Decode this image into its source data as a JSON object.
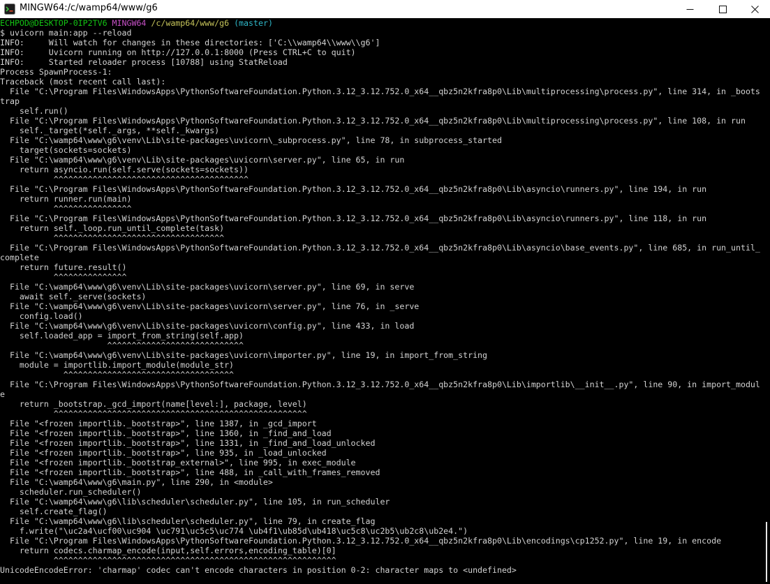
{
  "window": {
    "title": "MINGW64:/c/wamp64/www/g6",
    "controls": {
      "minimize": "minimize",
      "maximize": "maximize",
      "close": "close"
    }
  },
  "terminal": {
    "colors": {
      "default": "#d3d3d3",
      "user_host": "#13c313",
      "shell": "#c651c6",
      "path": "#c5c35a",
      "branch": "#2fb7c8"
    },
    "prompt": {
      "user_host": "ECHPOD@DESKTOP-0IP2TV6",
      "shell": "MINGW64",
      "path": "/c/wamp64/www/g6",
      "branch": "(master)"
    },
    "lines": [
      "$ uvicorn main:app --reload",
      "INFO:     Will watch for changes in these directories: ['C:\\\\wamp64\\\\www\\\\g6']",
      "INFO:     Uvicorn running on http://127.0.0.1:8000 (Press CTRL+C to quit)",
      "INFO:     Started reloader process [10788] using StatReload",
      "Process SpawnProcess-1:",
      "Traceback (most recent call last):",
      "  File \"C:\\Program Files\\WindowsApps\\PythonSoftwareFoundation.Python.3.12_3.12.752.0_x64__qbz5n2kfra8p0\\Lib\\multiprocessing\\process.py\", line 314, in _boots",
      "trap",
      "    self.run()",
      "  File \"C:\\Program Files\\WindowsApps\\PythonSoftwareFoundation.Python.3.12_3.12.752.0_x64__qbz5n2kfra8p0\\Lib\\multiprocessing\\process.py\", line 108, in run",
      "    self._target(*self._args, **self._kwargs)",
      "  File \"C:\\wamp64\\www\\g6\\venv\\Lib\\site-packages\\uvicorn\\_subprocess.py\", line 78, in subprocess_started",
      "    target(sockets=sockets)",
      "  File \"C:\\wamp64\\www\\g6\\venv\\Lib\\site-packages\\uvicorn\\server.py\", line 65, in run",
      "    return asyncio.run(self.serve(sockets=sockets))",
      "           ^^^^^^^^^^^^^^^^^^^^^^^^^^^^^^^^^^^^^^^^",
      "  File \"C:\\Program Files\\WindowsApps\\PythonSoftwareFoundation.Python.3.12_3.12.752.0_x64__qbz5n2kfra8p0\\Lib\\asyncio\\runners.py\", line 194, in run",
      "    return runner.run(main)",
      "           ^^^^^^^^^^^^^^^^",
      "  File \"C:\\Program Files\\WindowsApps\\PythonSoftwareFoundation.Python.3.12_3.12.752.0_x64__qbz5n2kfra8p0\\Lib\\asyncio\\runners.py\", line 118, in run",
      "    return self._loop.run_until_complete(task)",
      "           ^^^^^^^^^^^^^^^^^^^^^^^^^^^^^^^^^^^",
      "  File \"C:\\Program Files\\WindowsApps\\PythonSoftwareFoundation.Python.3.12_3.12.752.0_x64__qbz5n2kfra8p0\\Lib\\asyncio\\base_events.py\", line 685, in run_until_",
      "complete",
      "    return future.result()",
      "           ^^^^^^^^^^^^^^^",
      "  File \"C:\\wamp64\\www\\g6\\venv\\Lib\\site-packages\\uvicorn\\server.py\", line 69, in serve",
      "    await self._serve(sockets)",
      "  File \"C:\\wamp64\\www\\g6\\venv\\Lib\\site-packages\\uvicorn\\server.py\", line 76, in _serve",
      "    config.load()",
      "  File \"C:\\wamp64\\www\\g6\\venv\\Lib\\site-packages\\uvicorn\\config.py\", line 433, in load",
      "    self.loaded_app = import_from_string(self.app)",
      "                      ^^^^^^^^^^^^^^^^^^^^^^^^^^^^",
      "  File \"C:\\wamp64\\www\\g6\\venv\\Lib\\site-packages\\uvicorn\\importer.py\", line 19, in import_from_string",
      "    module = importlib.import_module(module_str)",
      "             ^^^^^^^^^^^^^^^^^^^^^^^^^^^^^^^^^^^",
      "  File \"C:\\Program Files\\WindowsApps\\PythonSoftwareFoundation.Python.3.12_3.12.752.0_x64__qbz5n2kfra8p0\\Lib\\importlib\\__init__.py\", line 90, in import_modul",
      "e",
      "    return _bootstrap._gcd_import(name[level:], package, level)",
      "           ^^^^^^^^^^^^^^^^^^^^^^^^^^^^^^^^^^^^^^^^^^^^^^^^^^^^",
      "  File \"<frozen importlib._bootstrap>\", line 1387, in _gcd_import",
      "  File \"<frozen importlib._bootstrap>\", line 1360, in _find_and_load",
      "  File \"<frozen importlib._bootstrap>\", line 1331, in _find_and_load_unlocked",
      "  File \"<frozen importlib._bootstrap>\", line 935, in _load_unlocked",
      "  File \"<frozen importlib._bootstrap_external>\", line 995, in exec_module",
      "  File \"<frozen importlib._bootstrap>\", line 488, in _call_with_frames_removed",
      "  File \"C:\\wamp64\\www\\g6\\main.py\", line 290, in <module>",
      "    scheduler.run_scheduler()",
      "  File \"C:\\wamp64\\www\\g6\\lib\\scheduler\\scheduler.py\", line 105, in run_scheduler",
      "    self.create_flag()",
      "  File \"C:\\wamp64\\www\\g6\\lib\\scheduler\\scheduler.py\", line 79, in create_flag",
      "    f.write(\"\\uc2a4\\ucf00\\uc904 \\uc791\\uc5c5\\uc774 \\ub4f1\\ub85d\\ub418\\uc5c8\\uc2b5\\ub2c8\\ub2e4.\")",
      "  File \"C:\\Program Files\\WindowsApps\\PythonSoftwareFoundation.Python.3.12_3.12.752.0_x64__qbz5n2kfra8p0\\Lib\\encodings\\cp1252.py\", line 19, in encode",
      "    return codecs.charmap_encode(input,self.errors,encoding_table)[0]",
      "           ^^^^^^^^^^^^^^^^^^^^^^^^^^^^^^^^^^^^^^^^^^^^^^^^^^^^^^^^^^",
      "UnicodeEncodeError: 'charmap' codec can't encode characters in position 0-2: character maps to <undefined>"
    ]
  }
}
